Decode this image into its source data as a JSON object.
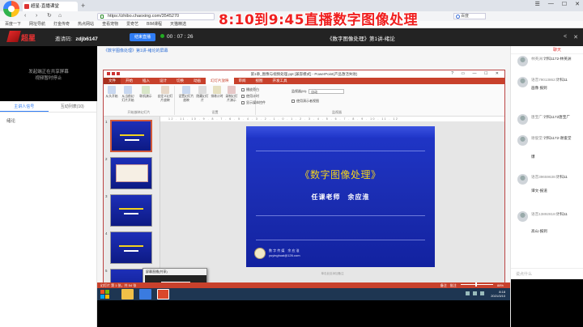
{
  "browser": {
    "tab_title": "超星-直播课堂",
    "tab_close": "×",
    "tab_new": "+",
    "url": "https://zhibo.chaoxing.com/3545270",
    "search_placeholder": "百度",
    "window_controls": [
      "☰",
      "—",
      "☐",
      "✕"
    ],
    "nav": [
      "‹",
      "›",
      "↻",
      "⌂"
    ],
    "bookmarks": [
      "百度一下",
      "网址导航",
      "打金传奇",
      "热点网站",
      "查看宠物",
      "爱奇艺",
      "BIM课程",
      "天猫精选"
    ]
  },
  "overlay_title": "8:10到9:45直播数字图像处理",
  "header": {
    "logo_text": "超星",
    "invite_label": "邀请码:",
    "invite_code": "zdjb6147",
    "live_button": "结束直播",
    "timer": "00 : 07 : 26",
    "course_title": "《数字图像处理》第1讲-绪论",
    "icons": [
      "share-icon",
      "close-icon"
    ]
  },
  "left": {
    "video_message_line1": "发起端正在共享屏幕",
    "video_message_line2": "视频暂时停止",
    "tabs": [
      "主讲人信号",
      "互动列表(10)"
    ],
    "item": "绪论"
  },
  "center": {
    "breadcrumb": "《数字图像处理》第1讲-绪论的屏幕"
  },
  "ppt": {
    "window_title": "第1章_图像与视频处理.ppt [兼容模式] - PowerPoint(产品激活失败)",
    "window_controls": "? ▭ — ☐ ✕",
    "tabs": [
      "文件",
      "开始",
      "插入",
      "设计",
      "切换",
      "动画",
      "幻灯片放映",
      "审阅",
      "视图",
      "开发工具"
    ],
    "active_tab": "幻灯片放映",
    "groups": [
      "开始放映幻灯片",
      "设置",
      "监视器"
    ],
    "buttons": [
      "从头开始",
      "从当前幻灯片开始",
      "联机演示",
      "自定义幻灯片放映",
      "设置幻灯片放映",
      "隐藏幻灯片",
      "排练计时",
      "录制幻灯片演示"
    ],
    "checks": [
      "播放旁白",
      "使用计时",
      "显示媒体控件"
    ],
    "monitor_label": "监视器(M):",
    "monitor_value": "自动",
    "presenter_view": "使用演示者视图",
    "ruler": "12 . 11 . 10 . 9 . 8 . 7 . 6 . 5 . 4 . 3 . 2 . 1 . 0 . 1 . 2 . 3 . 4 . 5 . 6 . 7 . 8 . 9 . 10 . 11 . 12",
    "thumb_numbers": [
      "1",
      "2",
      "3",
      "4",
      "5"
    ],
    "slide_title": "《数字图像处理》",
    "slide_subtitle": "任课老师　余应淮",
    "slide_footer1": "数 字 传 媒　余 应 淮",
    "slide_footer2": "yuyinghuai@126.com",
    "notes_hint": "单击此处添加备注",
    "status_left": "幻灯片 第 1 张，共 54 张",
    "status_right": "备注　批注",
    "zoom": "88%",
    "popup_title": "屏幕直播(共享)"
  },
  "taskbar": {
    "time": "8:18",
    "date": "2021/3/10"
  },
  "chat": {
    "tab": "聊天",
    "messages": [
      {
        "name": "林英洲:",
        "text": "计科1172-林英洲",
        "body": ""
      },
      {
        "name": "语音79013862:",
        "text": "计科11",
        "body": "画像 报到"
      },
      {
        "name": "唐宝广:",
        "text": "计科1172唐宝广",
        "body": ""
      },
      {
        "name": "谢俊堂:",
        "text": "计科1172-谢俊堂",
        "body": "爆"
      },
      {
        "name": "语音39659638:",
        "text": "计科11",
        "body": "谭文-报道"
      },
      {
        "name": "语音13892818:",
        "text": "计科11",
        "body": "高山-报到"
      }
    ],
    "input_placeholder": "说点什么"
  }
}
